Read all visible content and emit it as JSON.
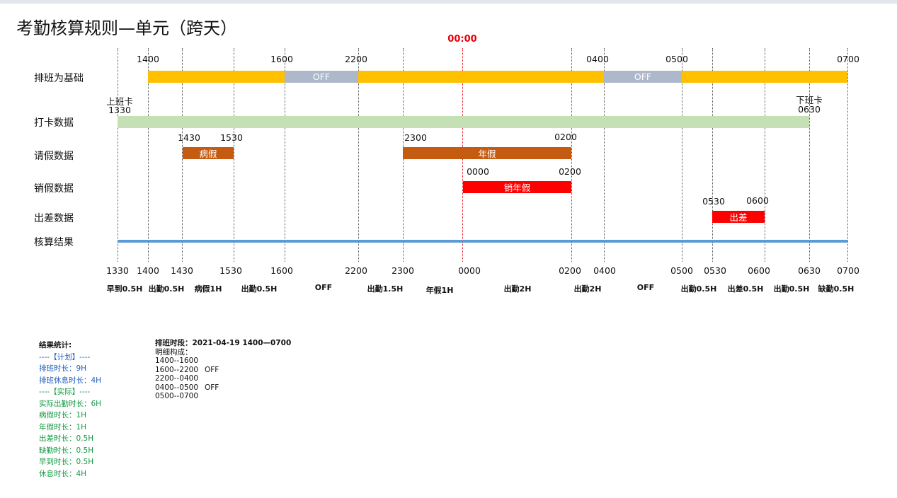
{
  "page": {
    "title": "考勤核算规则—单元（跨天）",
    "midnight_label": "00:00"
  },
  "rows": {
    "schedule": "排班为基础",
    "punch": "打卡数据",
    "leave": "请假数据",
    "cancel_leave": "销假数据",
    "business_trip": "出差数据",
    "result": "核算结果"
  },
  "colors": {
    "work": "#ffc000",
    "off": "#adb9ca",
    "punch": "#c5e0b4",
    "leave": "#c55a11",
    "cancel": "#ff0000",
    "trip": "#ff0000",
    "result": "#5b9bd5"
  },
  "schedule_ticks": [
    "1400",
    "1600",
    "2200",
    "0400",
    "0500",
    "0700"
  ],
  "schedule_bars": [
    {
      "type": "work",
      "label": ""
    },
    {
      "type": "off",
      "label": "OFF"
    },
    {
      "type": "work",
      "label": ""
    },
    {
      "type": "off",
      "label": "OFF"
    },
    {
      "type": "work",
      "label": ""
    }
  ],
  "punch": {
    "in_label": "上班卡",
    "in_time": "1330",
    "out_label": "下班卡",
    "out_time": "0630"
  },
  "leave": {
    "items": [
      {
        "start": "1430",
        "end": "1530",
        "label": "病假"
      },
      {
        "start": "2300",
        "end": "0200",
        "label": "年假"
      }
    ]
  },
  "cancel_leave": {
    "start": "0000",
    "end": "0200",
    "label": "销年假"
  },
  "business_trip": {
    "start": "0530",
    "end": "0600",
    "label": "出差"
  },
  "bottom_ticks": [
    "1330",
    "1400",
    "1430",
    "1530",
    "1600",
    "2200",
    "2300",
    "0000",
    "0200",
    "0400",
    "0500",
    "0530",
    "0600",
    "0630",
    "0700"
  ],
  "segments": [
    "早到0.5H",
    "出勤0.5H",
    "病假1H",
    "出勤0.5H",
    "OFF",
    "出勤1.5H",
    "年假1H",
    "出勤2H",
    "出勤2H",
    "OFF",
    "出勤0.5H",
    "出差0.5H",
    "出勤0.5H",
    "缺勤0.5H"
  ],
  "stats": {
    "title": "结果统计:",
    "plan_header": "----【计划】----",
    "plan": [
      "排班时长：9H",
      "排班休息时长：4H"
    ],
    "actual_header": "----【实际】----",
    "actual": [
      "实际出勤时长：6H",
      "病假时长：1H",
      "年假时长：1H",
      "出差时长：0.5H",
      "缺勤时长：0.5H",
      "早到时长：0.5H",
      "休息时长：4H"
    ]
  },
  "detail": {
    "title": "排班时段：2021-04-19   1400—0700",
    "subtitle": "明细构成：",
    "lines": [
      {
        "range": "1400--1600",
        "tag": ""
      },
      {
        "range": "1600--2200",
        "tag": "OFF"
      },
      {
        "range": "2200--0400",
        "tag": ""
      },
      {
        "range": "0400--0500",
        "tag": "OFF"
      },
      {
        "range": "0500--0700",
        "tag": ""
      }
    ]
  }
}
